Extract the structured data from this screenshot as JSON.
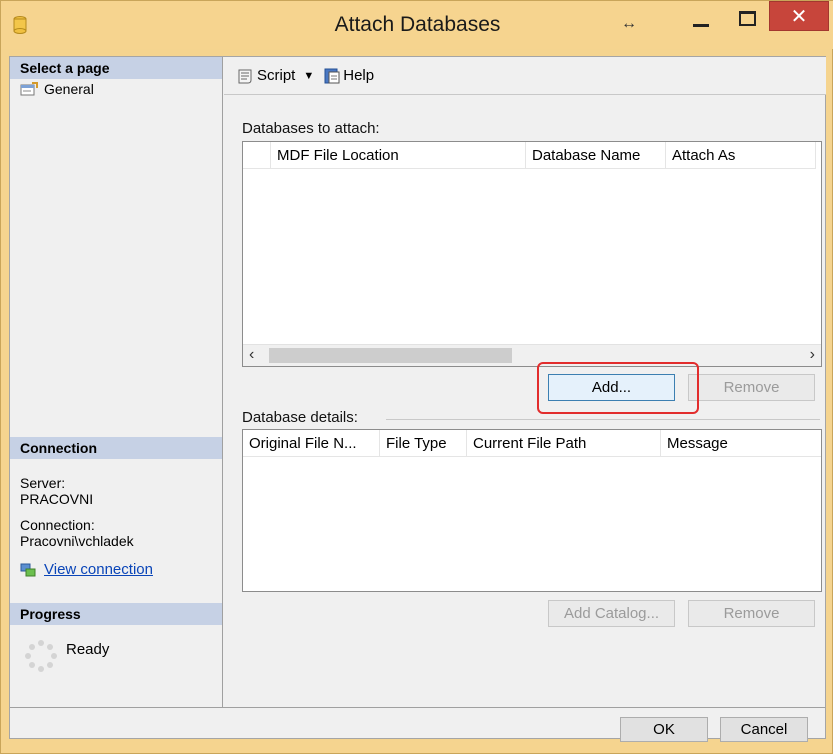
{
  "window": {
    "title": "Attach Databases",
    "colors": {
      "frame": "#f6d48f",
      "close": "#c7453b",
      "pane_header": "#c6d1e5",
      "highlight": "#e22d2d",
      "link": "#0a45b8"
    }
  },
  "left": {
    "select_page_heading": "Select a page",
    "pages": [
      {
        "label": "General",
        "icon": "properties-icon"
      }
    ],
    "connection_heading": "Connection",
    "server_label": "Server:",
    "server_value": "PRACOVNI",
    "connection_label": "Connection:",
    "connection_value": "Pracovni\\vchladek",
    "view_connection": "View connection",
    "progress_heading": "Progress",
    "progress_status": "Ready"
  },
  "toolbar": {
    "script_label": "Script",
    "help_label": "Help"
  },
  "databases": {
    "label": "Databases to attach:",
    "columns": [
      "MDF File Location",
      "Database Name",
      "Attach As"
    ],
    "add_label": "Add...",
    "remove_label": "Remove"
  },
  "details": {
    "label": "Database details:",
    "columns": [
      "Original File N...",
      "File Type",
      "Current File Path",
      "Message"
    ],
    "add_catalog_label": "Add Catalog...",
    "remove_label": "Remove"
  },
  "footer": {
    "ok_label": "OK",
    "cancel_label": "Cancel"
  }
}
